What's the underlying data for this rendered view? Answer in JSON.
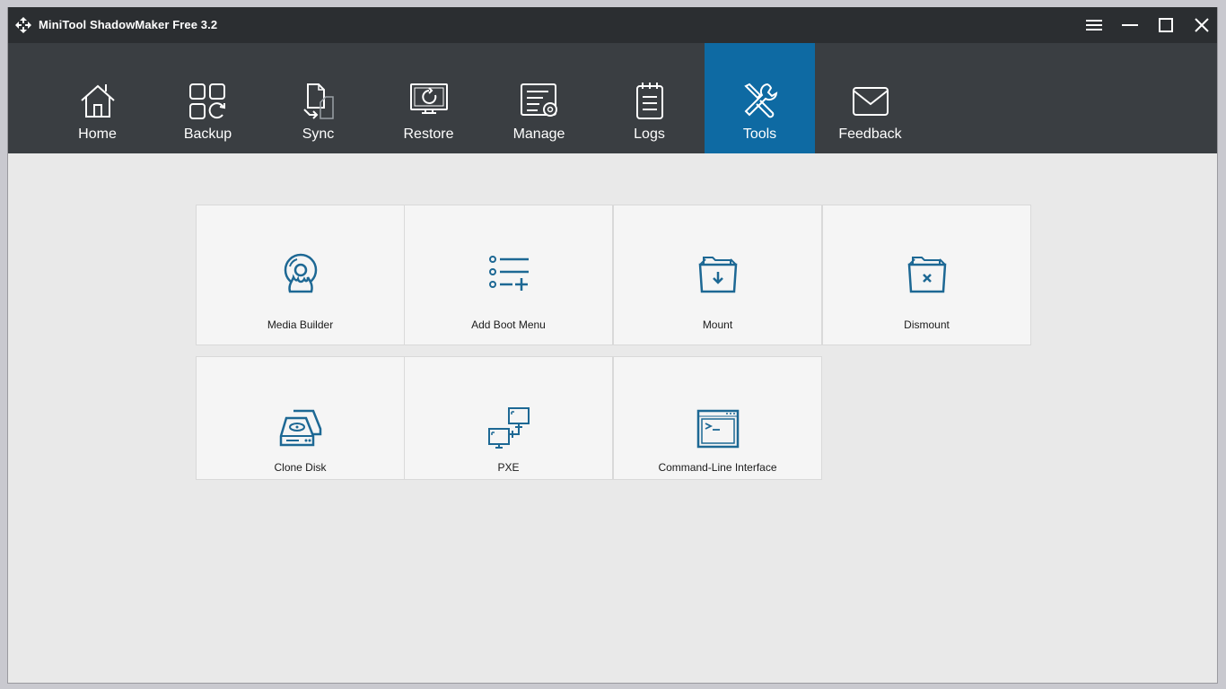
{
  "window": {
    "title": "MiniTool ShadowMaker Free 3.2"
  },
  "window_controls": [
    {
      "name": "menu-icon"
    },
    {
      "name": "minimize-icon"
    },
    {
      "name": "maximize-icon"
    },
    {
      "name": "close-icon"
    }
  ],
  "nav": {
    "active": "Tools",
    "items": [
      {
        "label": "Home",
        "icon": "home-icon"
      },
      {
        "label": "Backup",
        "icon": "backup-icon"
      },
      {
        "label": "Sync",
        "icon": "sync-icon"
      },
      {
        "label": "Restore",
        "icon": "restore-icon"
      },
      {
        "label": "Manage",
        "icon": "manage-icon"
      },
      {
        "label": "Logs",
        "icon": "logs-icon"
      },
      {
        "label": "Tools",
        "icon": "tools-icon"
      },
      {
        "label": "Feedback",
        "icon": "feedback-icon"
      }
    ]
  },
  "tools": [
    {
      "label": "Media Builder",
      "icon": "media-builder-icon"
    },
    {
      "label": "Add Boot Menu",
      "icon": "boot-menu-icon"
    },
    {
      "label": "Mount",
      "icon": "mount-icon"
    },
    {
      "label": "Dismount",
      "icon": "dismount-icon"
    },
    {
      "label": "Clone Disk",
      "icon": "clone-disk-icon"
    },
    {
      "label": "PXE",
      "icon": "pxe-icon"
    },
    {
      "label": "Command-Line Interface",
      "icon": "command-line-icon"
    }
  ],
  "colors": {
    "titlebar": "#2b2e31",
    "navbar": "#3a3e42",
    "active_tab": "#0e6aa3",
    "content_bg": "#e9e9e9",
    "tile_bg": "#f5f5f5",
    "icon_blue": "#1d6894"
  }
}
